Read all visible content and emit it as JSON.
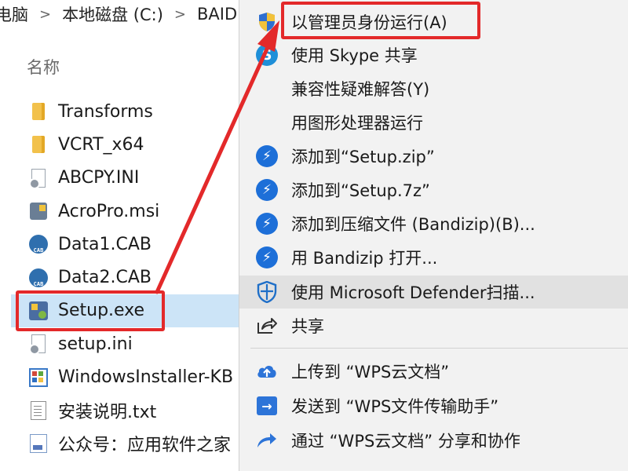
{
  "explorer": {
    "breadcrumb": [
      "电脑",
      "本地磁盘 (C:)",
      "BAID"
    ],
    "column_header": "名称",
    "files": [
      {
        "name": "Transforms",
        "icon": "folder-icon",
        "selected": false
      },
      {
        "name": "VCRT_x64",
        "icon": "folder-icon",
        "selected": false
      },
      {
        "name": "ABCPY.INI",
        "icon": "ini-file-icon",
        "selected": false
      },
      {
        "name": "AcroPro.msi",
        "icon": "msi-file-icon",
        "selected": false
      },
      {
        "name": "Data1.CAB",
        "icon": "cab-file-icon",
        "selected": false
      },
      {
        "name": "Data2.CAB",
        "icon": "cab-file-icon",
        "selected": false
      },
      {
        "name": "Setup.exe",
        "icon": "exe-file-icon",
        "selected": true
      },
      {
        "name": "setup.ini",
        "icon": "ini-file-icon",
        "selected": false
      },
      {
        "name": "WindowsInstaller-KB",
        "icon": "installer-file-icon",
        "selected": false
      },
      {
        "name": "安装说明.txt",
        "icon": "txt-file-icon",
        "selected": false
      },
      {
        "name": "公众号：应用软件之家",
        "icon": "doc-file-icon",
        "selected": false
      }
    ]
  },
  "context_menu": {
    "items": [
      {
        "label": "以管理员身份运行(A)",
        "icon": "uac-shield-icon"
      },
      {
        "label": "使用 Skype 共享",
        "icon": "skype-icon"
      },
      {
        "label": "兼容性疑难解答(Y)",
        "icon": ""
      },
      {
        "label": "用图形处理器运行",
        "icon": ""
      },
      {
        "label": "添加到“Setup.zip”",
        "icon": "bandizip-icon"
      },
      {
        "label": "添加到“Setup.7z”",
        "icon": "bandizip-icon"
      },
      {
        "label": "添加到压缩文件 (Bandizip)(B)...",
        "icon": "bandizip-icon"
      },
      {
        "label": "用 Bandizip 打开...",
        "icon": "bandizip-icon"
      },
      {
        "label": "使用 Microsoft Defender扫描...",
        "icon": "defender-icon"
      },
      {
        "label": "共享",
        "icon": "share-icon"
      },
      {
        "label": "上传到 “WPS云文档”",
        "icon": "cloud-upload-icon"
      },
      {
        "label": "发送到 “WPS文件传输助手”",
        "icon": "send-icon"
      },
      {
        "label": "通过 “WPS云文档” 分享和协作",
        "icon": "share-arrow-icon"
      }
    ]
  },
  "colors": {
    "annotation_red": "#e3292a",
    "selection_blue": "#cce4f7",
    "menu_bg": "#f2f2f2"
  }
}
